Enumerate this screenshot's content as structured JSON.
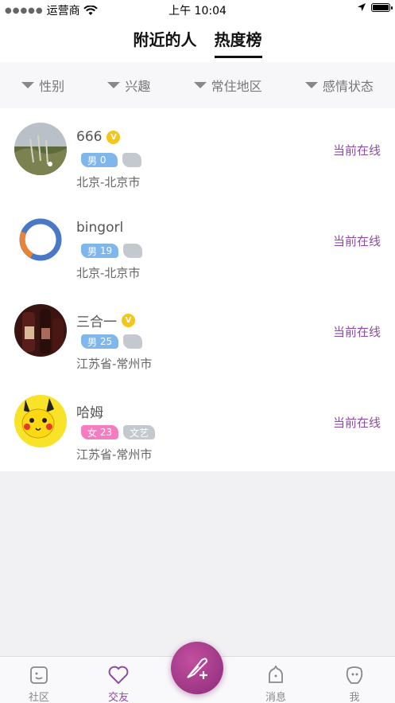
{
  "status_bar": {
    "carrier": "运营商",
    "time": "上午 10:04"
  },
  "nav": {
    "tabs": [
      "附近的人",
      "热度榜"
    ],
    "active_index": 1
  },
  "filters": [
    "性别",
    "兴趣",
    "常住地区",
    "感情状态"
  ],
  "users": [
    {
      "name": "666",
      "vip": true,
      "gender": "男",
      "age": "0",
      "interest": "",
      "location": "北京-北京市",
      "status": "当前在线",
      "avatar": "landscape"
    },
    {
      "name": "bingorl",
      "vip": false,
      "gender": "男",
      "age": "19",
      "interest": "",
      "location": "北京-北京市",
      "status": "当前在线",
      "avatar": "ring"
    },
    {
      "name": "三合一",
      "vip": true,
      "gender": "男",
      "age": "25",
      "interest": "",
      "location": "江苏省-常州市",
      "status": "当前在线",
      "avatar": "bottles"
    },
    {
      "name": "哈姆",
      "vip": false,
      "gender": "女",
      "age": "23",
      "interest": "文艺",
      "location": "江苏省-常州市",
      "status": "当前在线",
      "avatar": "pikachu"
    }
  ],
  "tabbar": {
    "items": [
      "社区",
      "交友",
      "消息",
      "我"
    ],
    "active_index": 1
  },
  "colors": {
    "accent": "#8a4da1",
    "male_tag": "#7fb6ec",
    "female_tag": "#f57cc1",
    "vip": "#f5c518"
  }
}
